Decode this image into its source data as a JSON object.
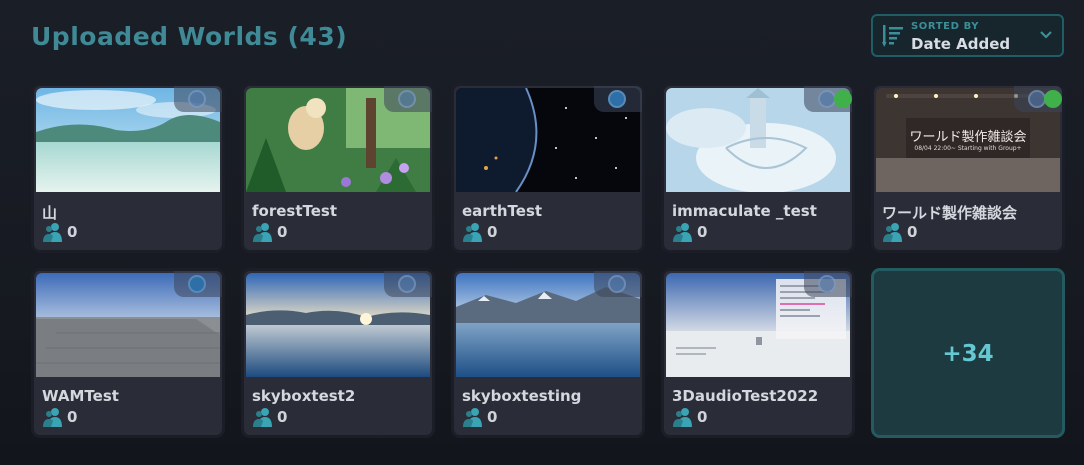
{
  "header": {
    "title": "Uploaded Worlds (43)"
  },
  "sort": {
    "caption": "SORTED BY",
    "value": "Date Added"
  },
  "worlds": [
    {
      "name": "山",
      "users": "0"
    },
    {
      "name": "forestTest",
      "users": "0"
    },
    {
      "name": "earthTest",
      "users": "0"
    },
    {
      "name": "immaculate _test",
      "users": "0"
    },
    {
      "name": "ワールド製作雑談会",
      "users": "0",
      "thumb_text": "ワールド製作雑談会",
      "thumb_sub": "08/04 22:00~ Starting with Group+"
    },
    {
      "name": "WAMTest",
      "users": "0"
    },
    {
      "name": "skyboxtest2",
      "users": "0"
    },
    {
      "name": "skyboxtesting",
      "users": "0"
    },
    {
      "name": "3DaudioTest2022",
      "users": "0"
    }
  ],
  "more": {
    "label": "+34"
  },
  "colors": {
    "accent": "#3f8a96",
    "tile_more_bg": "#1c3a3f",
    "user_icon": "#3aa3b4"
  }
}
